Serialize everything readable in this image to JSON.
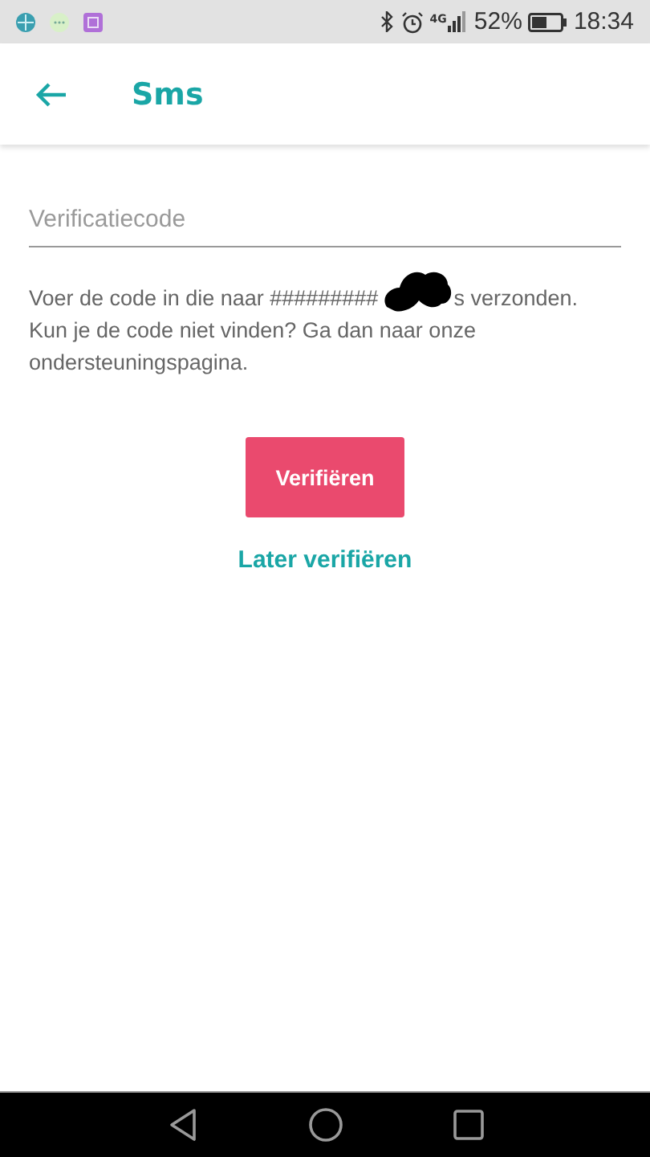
{
  "status_bar": {
    "network": "4G",
    "battery": "52%",
    "time": "18:34"
  },
  "header": {
    "title": "Sms"
  },
  "code_field": {
    "placeholder": "Verificatiecode"
  },
  "message": {
    "before_redaction": "Voer de code in die naar #########",
    "after_redaction": "s verzonden.",
    "help": "Kun je de code niet vinden? Ga dan naar onze ondersteuningspagina."
  },
  "verify_button": {
    "label": "Verifiëren"
  },
  "later_link": {
    "label": "Later verifiëren"
  }
}
